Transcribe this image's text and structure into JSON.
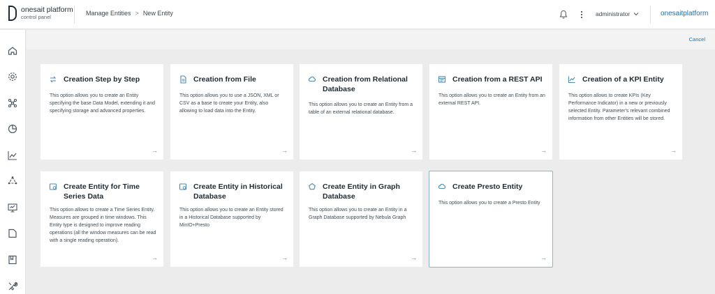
{
  "header": {
    "logo_line1": "onesait platform",
    "logo_line2": "control panel",
    "breadcrumb": [
      "Manage Entities",
      "New Entity"
    ],
    "breadcrumb_separator": ">",
    "user": "administrator",
    "brand": "onesaitplatform"
  },
  "toolbar": {
    "cancel_label": "Cancel"
  },
  "sidebar": {
    "items": [
      {
        "icon": "home-icon"
      },
      {
        "icon": "gear-icon"
      },
      {
        "icon": "network-icon"
      },
      {
        "icon": "pie-chart-icon"
      },
      {
        "icon": "line-chart-icon"
      },
      {
        "icon": "cycle-icon"
      },
      {
        "icon": "monitor-icon"
      },
      {
        "icon": "folder-icon"
      },
      {
        "icon": "book-icon"
      },
      {
        "icon": "tools-icon"
      }
    ]
  },
  "cards": [
    {
      "title": "Creation Step by Step",
      "icon": "steps-icon",
      "desc": "This option allows you to create an Entity specifying the base Data Model, extending it and specifying storage and advanced properties."
    },
    {
      "title": "Creation from File",
      "icon": "file-icon",
      "desc": "This option allows you to use a JSON, XML or CSV as a base to create your Entity, also allowing to load data into the Entity."
    },
    {
      "title": "Creation from Relational Database",
      "icon": "cloud-db-icon",
      "desc": "This option allows you to create an Entity from a table of an external relational database."
    },
    {
      "title": "Creation from a REST API",
      "icon": "api-icon",
      "desc": "This option allows you to create an Entity from an external REST API."
    },
    {
      "title": "Creation of a KPI Entity",
      "icon": "kpi-chart-icon",
      "desc": "This option allows to create KPIs (Key Performance Indicator) in a new or previously selected Entity. Parameter's relevant combined information from other Entities will be stored."
    },
    {
      "title": "Create Entity for Time Series Data",
      "icon": "timeseries-icon",
      "desc": "This option allows to create a Time Series Entity. Measures are grouped in time windows. This Entity type is designed to improve reading operations (all the window measures can be read with a single reading operation)."
    },
    {
      "title": "Create Entity in Historical Database",
      "icon": "historical-db-icon",
      "desc": "This option allows you to create an Entity stored in a Historical Database supported by MinIO+Presto"
    },
    {
      "title": "Create Entity in Graph Database",
      "icon": "graph-icon",
      "desc": "This option allows you to create an Entity in a Graph Database supported by Nebula Graph"
    },
    {
      "title": "Create Presto Entity",
      "icon": "presto-icon",
      "desc": "This option allows you to create a Presto Entity"
    }
  ],
  "card_arrow": "→"
}
